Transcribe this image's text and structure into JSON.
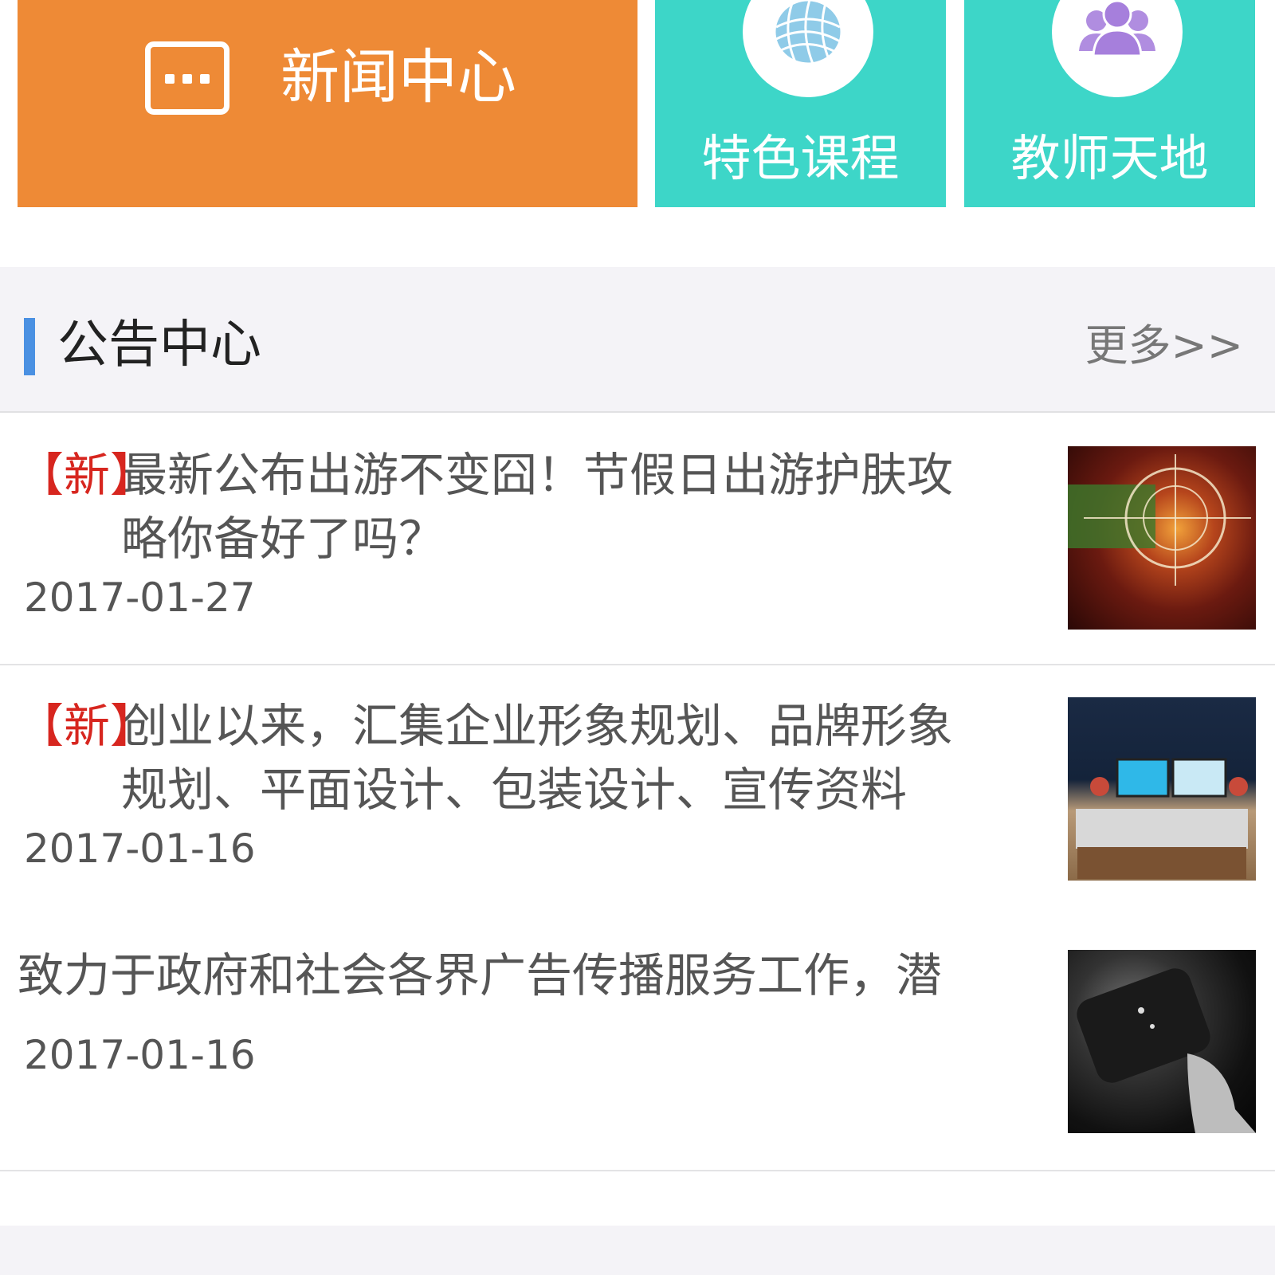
{
  "tiles": {
    "news": {
      "label": "新闻中心",
      "color": "#ee8a36",
      "icon": "chat-bubble-icon"
    },
    "course": {
      "label": "特色课程",
      "color": "#3dd6c8",
      "icon": "globe-icon"
    },
    "teacher": {
      "label": "教师天地",
      "color": "#3dd6c8",
      "icon": "users-icon"
    }
  },
  "notice": {
    "title": "公告中心",
    "more": "更多>>",
    "accent_color": "#4a90e2",
    "items": [
      {
        "badge": "【新】",
        "title": "最新公布出游不变囧！节假日出游护肤攻略你备好了吗？",
        "date": "2017-01-27",
        "thumb": "photo-thumbnail"
      },
      {
        "badge": "【新】",
        "title": "创业以来，汇集企业形象规划、品牌形象规划、平面设计、包装设计、宣传资料",
        "date": "2017-01-16",
        "thumb": "photo-thumbnail"
      },
      {
        "badge": "",
        "title": "致力于政府和社会各界广告传播服务工作，潜",
        "date": "2017-01-16",
        "thumb": "photo-thumbnail"
      }
    ]
  }
}
